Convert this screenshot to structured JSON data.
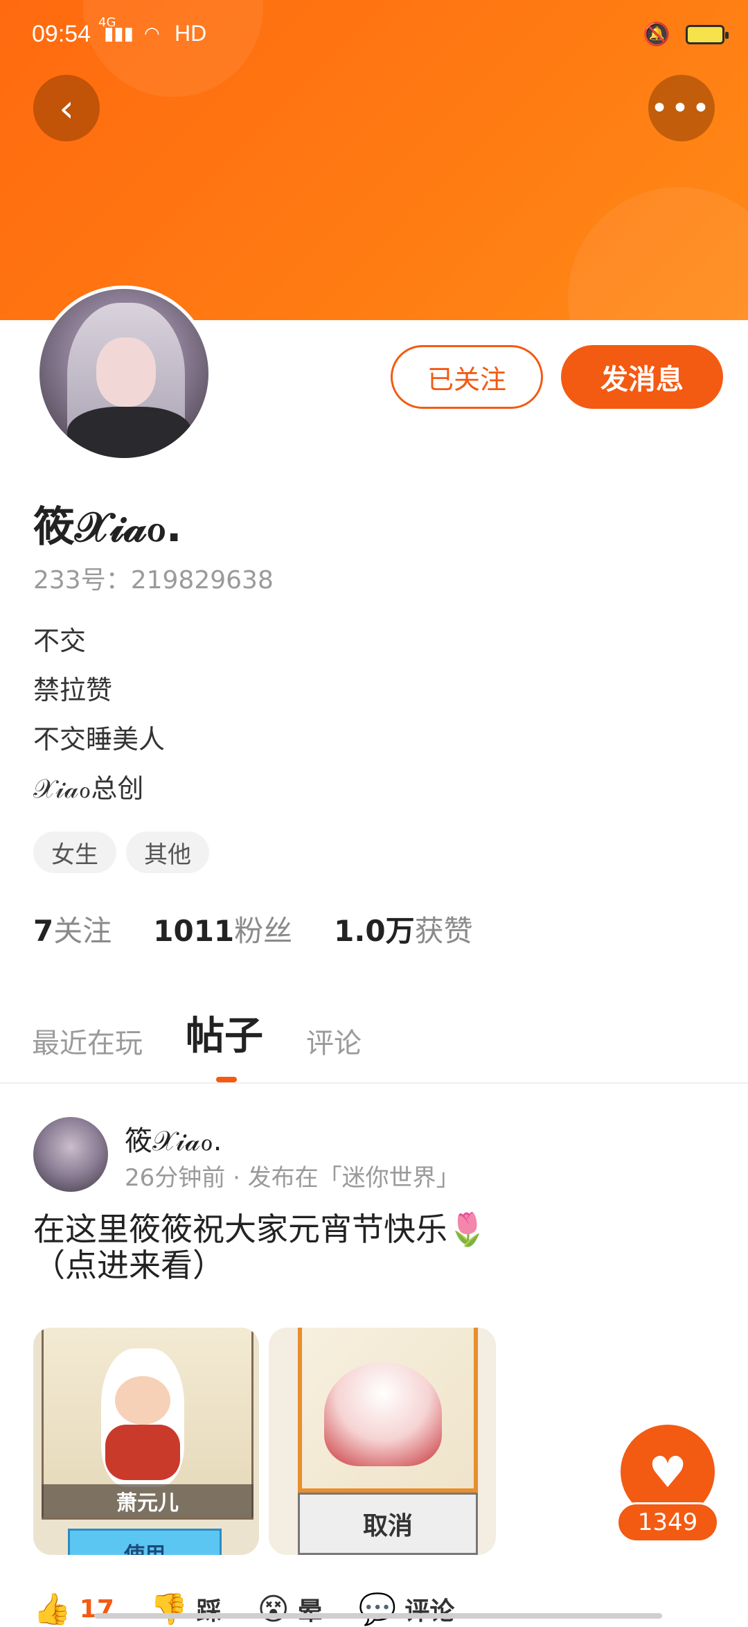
{
  "status_bar": {
    "time": "09:54",
    "network": "4G",
    "quality": "HD"
  },
  "header": {
    "back_icon": "back-arrow-icon",
    "more_icon": "more-dots-icon"
  },
  "profile": {
    "follow_label": "已关注",
    "message_label": "发消息",
    "username": "筱𝒳𝒾𝒶ℴ.",
    "id_line": "233号：219829638",
    "bio": [
      "不交",
      "禁拉赞",
      "不交睡美人",
      "𝒳𝒾𝒶ℴ总创"
    ],
    "tags": [
      "女生",
      "其他"
    ],
    "stats": [
      {
        "num": "7",
        "label": "关注"
      },
      {
        "num": "1011",
        "label": "粉丝"
      },
      {
        "num": "1.0万",
        "label": "获赞"
      }
    ]
  },
  "tabs": [
    {
      "label": "最近在玩",
      "active": false
    },
    {
      "label": "帖子",
      "active": true
    },
    {
      "label": "评论",
      "active": false
    }
  ],
  "post": {
    "author": "筱𝒳𝒾𝒶ℴ.",
    "meta": "26分钟前 · 发布在「迷你世界」",
    "text_line1": "在这里筱筱祝大家元宵节快乐🌷",
    "text_line2": "（点进来看）",
    "image1_name": "萧元儿",
    "image1_button": "使用",
    "image2_button": "取消",
    "actions": [
      {
        "icon": "thumbs-up-icon",
        "label": "17"
      },
      {
        "icon": "thumbs-down-icon",
        "label": "踩"
      },
      {
        "icon": "dizzy-face-icon",
        "label": "晕"
      },
      {
        "icon": "comment-icon",
        "label": "评论"
      }
    ]
  },
  "like_fab": {
    "icon": "heart-icon",
    "count": "1349"
  },
  "colors": {
    "accent": "#f35a12",
    "banner": "#ff7a12"
  }
}
